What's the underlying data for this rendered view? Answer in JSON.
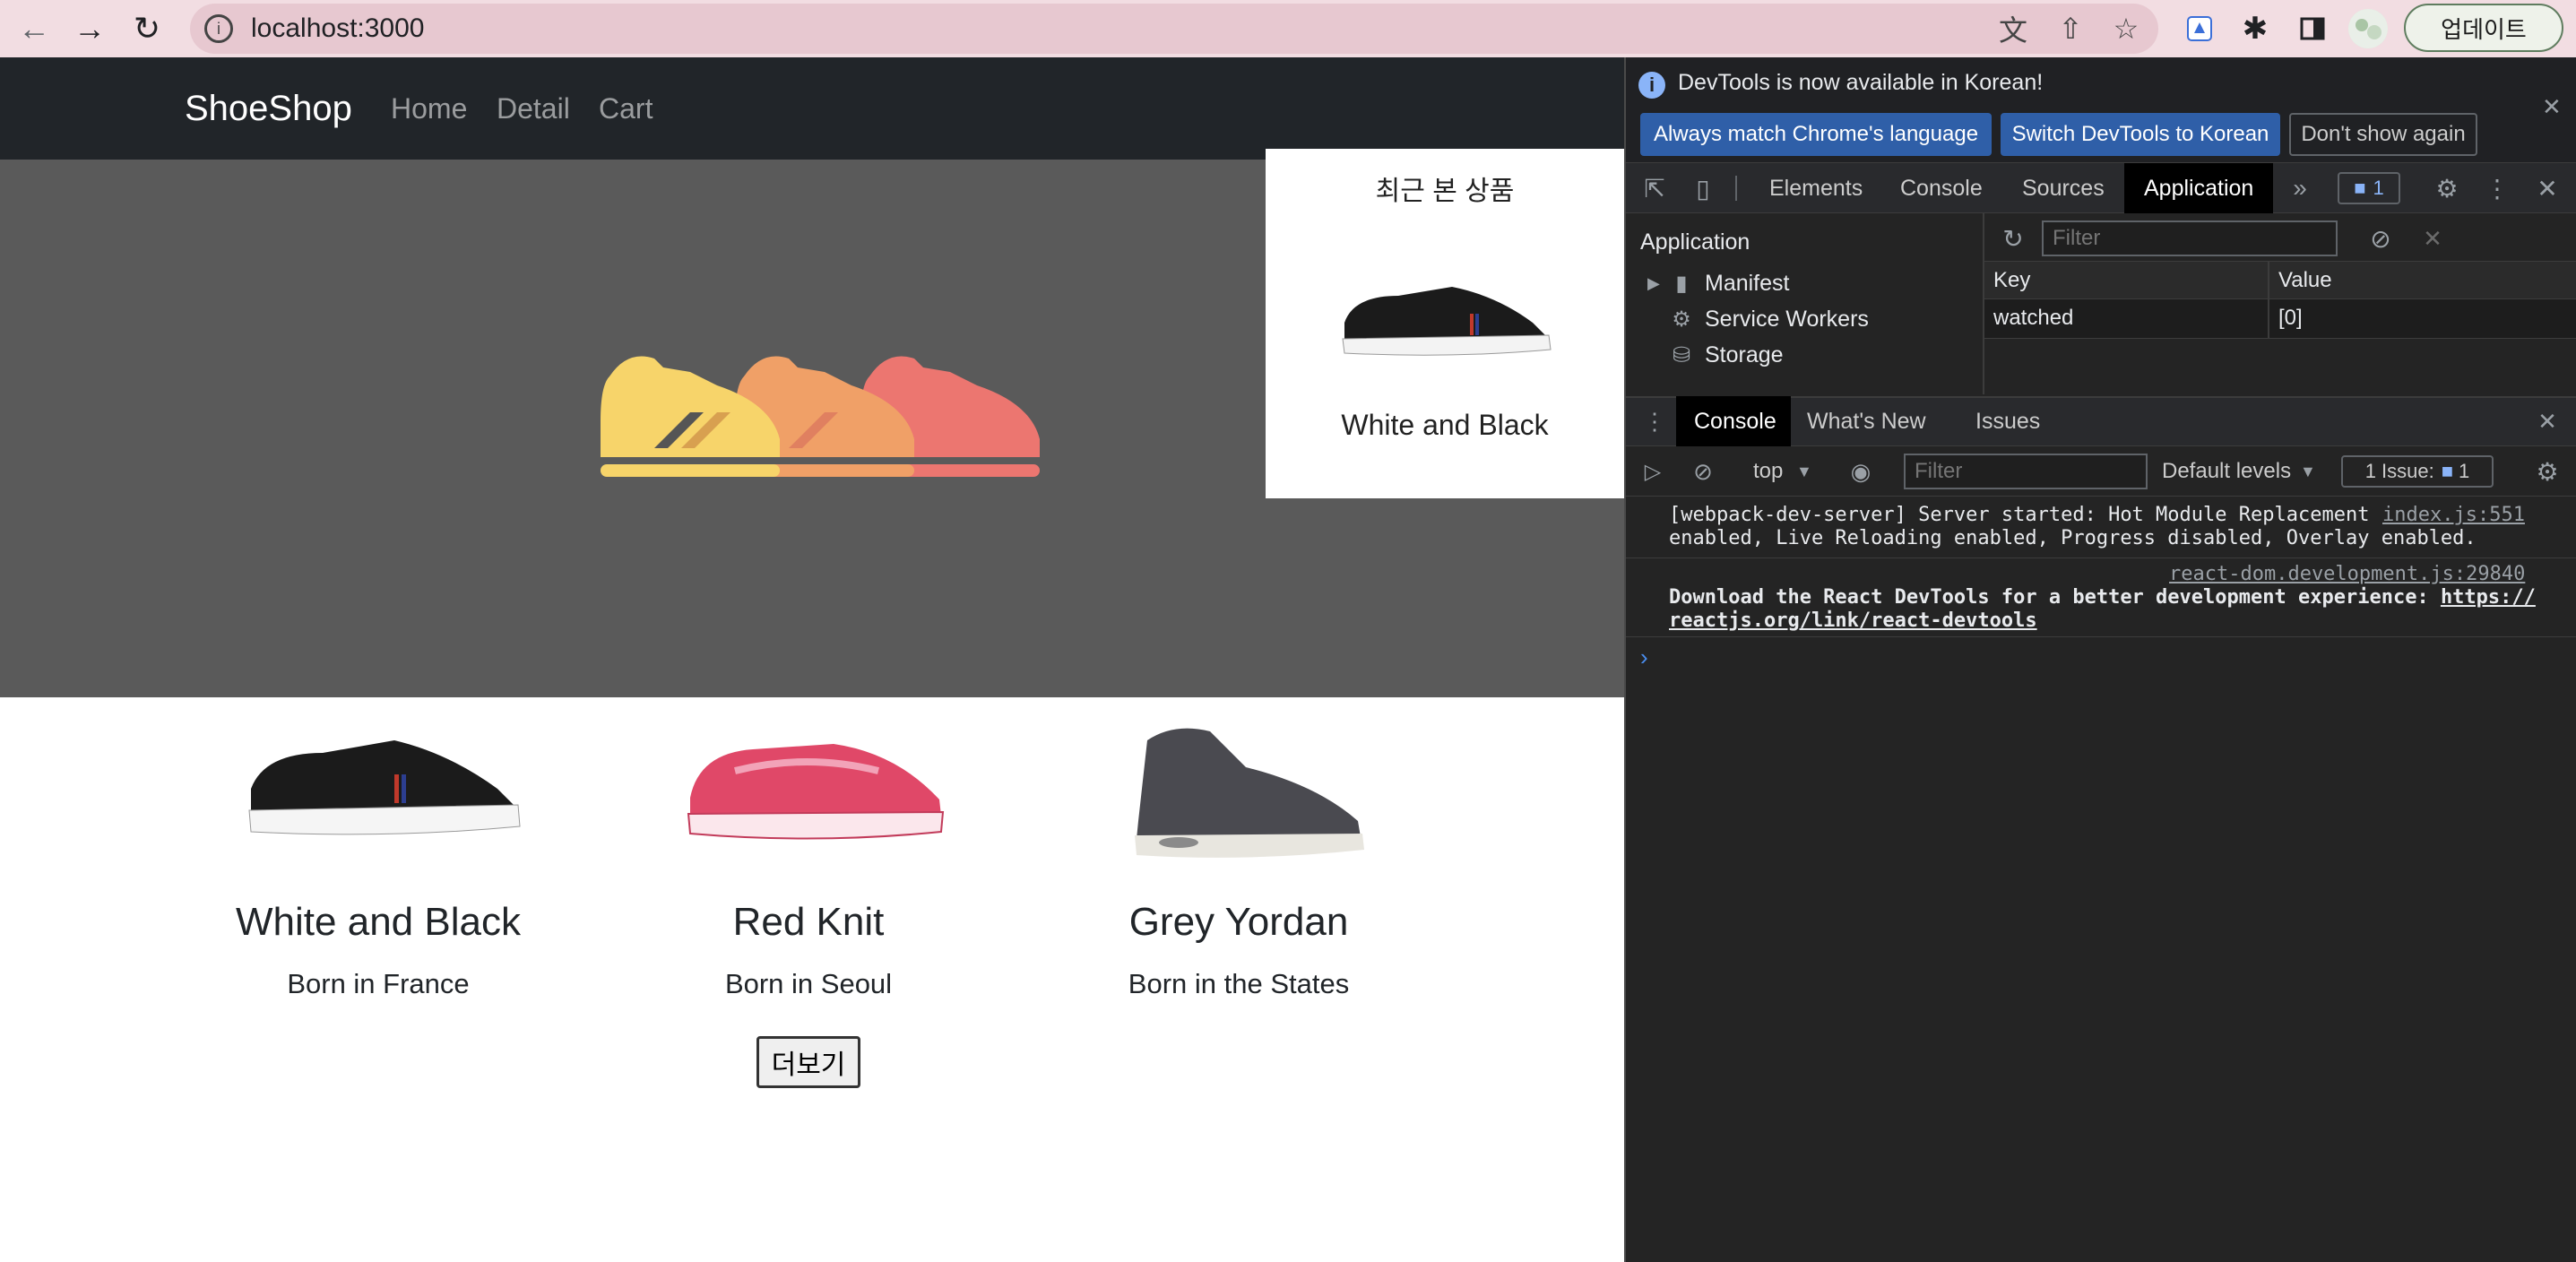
{
  "browser": {
    "url": "localhost:3000",
    "update_label": "업데이트"
  },
  "app": {
    "brand": "ShoeShop",
    "nav": [
      "Home",
      "Detail",
      "Cart"
    ],
    "recent": {
      "title": "최근 본 상품",
      "item_name": "White and Black"
    },
    "products": [
      {
        "name": "White and Black",
        "origin": "Born in France"
      },
      {
        "name": "Red Knit",
        "origin": "Born in Seoul"
      },
      {
        "name": "Grey Yordan",
        "origin": "Born in the States"
      }
    ],
    "more_label": "더보기"
  },
  "devtools": {
    "info_text": "DevTools is now available in Korean!",
    "info_buttons": [
      "Always match Chrome's language",
      "Switch DevTools to Korean",
      "Don't show again"
    ],
    "tabs": [
      "Elements",
      "Console",
      "Sources",
      "Application"
    ],
    "badge_count": "1",
    "application": {
      "sidebar_title": "Application",
      "items": [
        "Manifest",
        "Service Workers",
        "Storage"
      ],
      "filter_placeholder": "Filter",
      "key_header": "Key",
      "value_header": "Value",
      "rows": [
        {
          "key": "watched",
          "value": "[0]"
        }
      ]
    },
    "drawer_tabs": [
      "Console",
      "What's New",
      "Issues"
    ],
    "console": {
      "context": "top",
      "filter_placeholder": "Filter",
      "levels": "Default levels",
      "issues": "1 Issue:",
      "issues_count": "1",
      "logs": [
        {
          "line1": "[webpack-dev-server] Server started: Hot Module Replacement",
          "line2": "enabled, Live Reloading enabled, Progress disabled, Overlay enabled.",
          "source": "index.js:551"
        },
        {
          "source": "react-dom.development.js:29840",
          "line1": "Download the React DevTools for a better development experience: ",
          "link1": "https://",
          "link2": "reactjs.org/link/react-devtools"
        }
      ]
    }
  },
  "colors": {
    "hero_bg": "#5a5a5a",
    "navbar_bg": "#212529",
    "devtools_bg": "#242424",
    "accent_blue": "#1a73e8",
    "shoe_yellow": "#f7d46a",
    "shoe_orange": "#f0a067",
    "shoe_red": "#ec7670"
  }
}
